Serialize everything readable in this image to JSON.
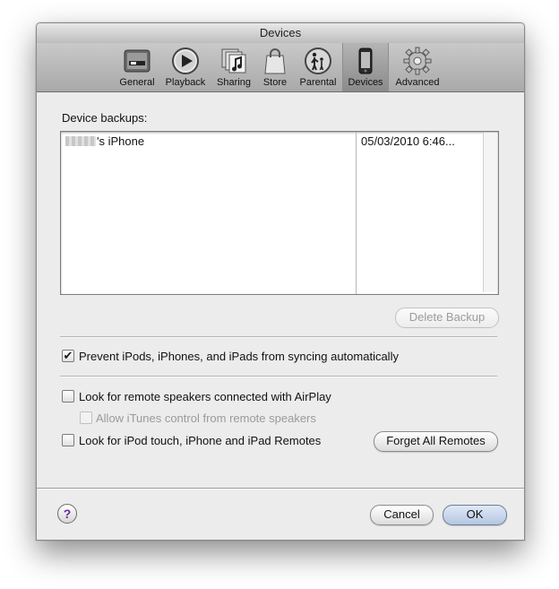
{
  "window": {
    "title": "Devices"
  },
  "toolbar": {
    "items": [
      {
        "label": "General",
        "icon": "general-switch-icon"
      },
      {
        "label": "Playback",
        "icon": "playback-icon"
      },
      {
        "label": "Sharing",
        "icon": "sharing-music-icon"
      },
      {
        "label": "Store",
        "icon": "store-bag-icon"
      },
      {
        "label": "Parental",
        "icon": "parental-icon"
      },
      {
        "label": "Devices",
        "icon": "iphone-icon",
        "selected": true
      },
      {
        "label": "Advanced",
        "icon": "gear-icon"
      }
    ]
  },
  "backups": {
    "label": "Device backups:",
    "rows": [
      {
        "device": "'s iPhone",
        "date": "05/03/2010 6:46..."
      }
    ],
    "delete_label": "Delete Backup"
  },
  "options": {
    "prevent_sync": {
      "label": "Prevent iPods, iPhones, and iPads from syncing automatically",
      "checked": true
    },
    "airplay": {
      "label": "Look for remote speakers connected with AirPlay",
      "checked": false
    },
    "itunes_control": {
      "label": "Allow iTunes control from remote speakers",
      "checked": false,
      "enabled": false
    },
    "remotes": {
      "label": "Look for iPod touch, iPhone and iPad Remotes",
      "checked": false
    },
    "forget_label": "Forget All Remotes"
  },
  "footer": {
    "help": "?",
    "cancel_label": "Cancel",
    "ok_label": "OK"
  },
  "colors": {
    "accent": "#6a2d9c",
    "default_button": "#b4c6e2"
  }
}
